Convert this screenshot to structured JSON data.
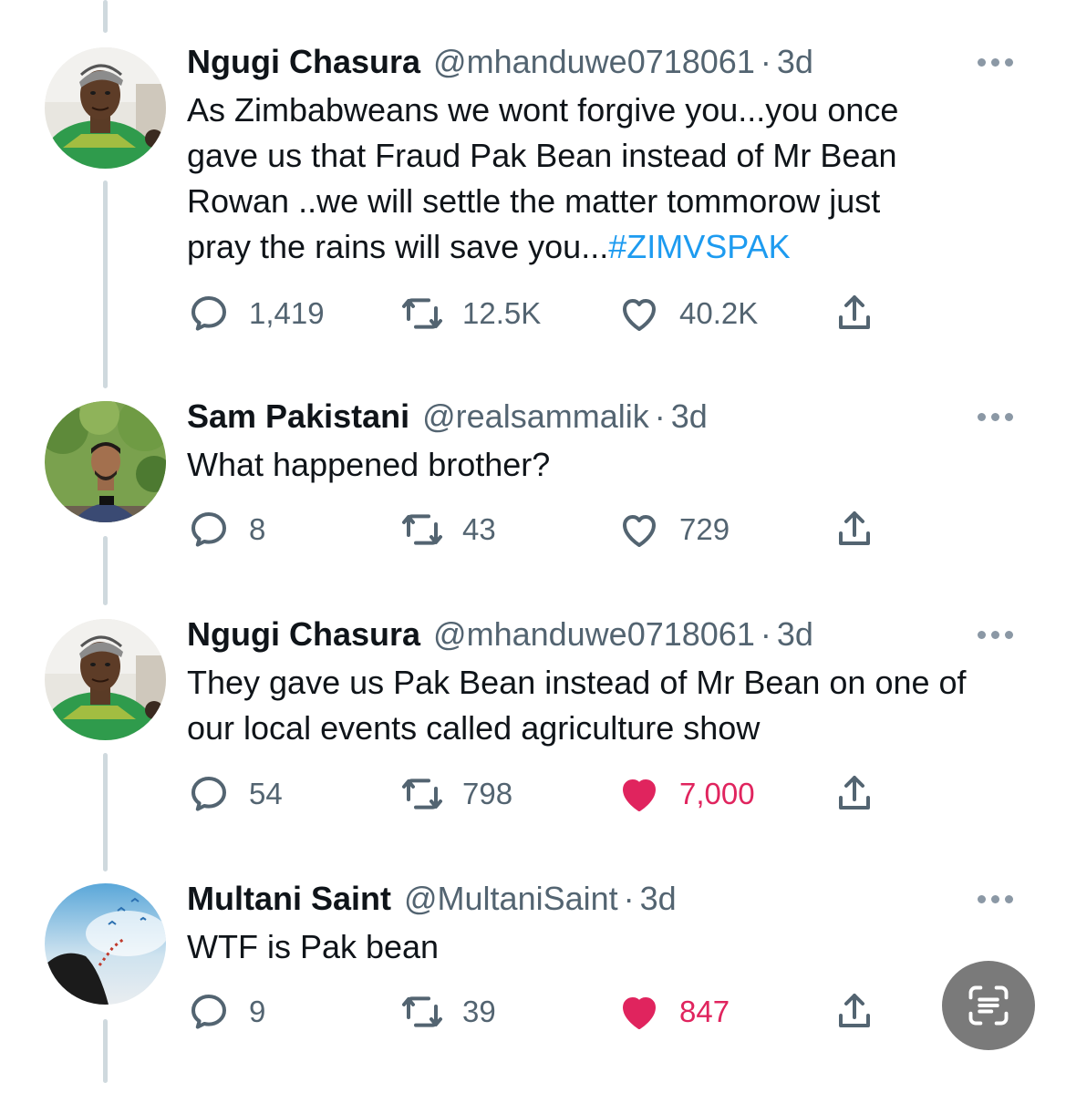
{
  "colors": {
    "link": "#1d9bf0",
    "like_active": "#e0245e",
    "muted": "#536471",
    "thread_line": "#cfd9de"
  },
  "tweets": [
    {
      "name": "Ngugi Chasura",
      "handle": "@mhanduwe0718061",
      "separator": "·",
      "time": "3d",
      "text_lines": [
        "As Zimbabweans we wont forgive you...you once",
        "gave us that Fraud Pak Bean instead of Mr Bean",
        "Rowan ..we will settle the matter tommorow just",
        "pray the rains will save you..."
      ],
      "hashtag": "#ZIMVSPAK",
      "replies": "1,419",
      "retweets": "12.5K",
      "likes": "40.2K",
      "liked": false,
      "avatar_icon": "person-green-jersey-avatar"
    },
    {
      "name": "Sam Pakistani",
      "handle": "@realsammalik",
      "separator": "·",
      "time": "3d",
      "text_lines": [
        "What happened brother?"
      ],
      "replies": "8",
      "retweets": "43",
      "likes": "729",
      "liked": false,
      "avatar_icon": "person-outdoor-avatar"
    },
    {
      "name": "Ngugi Chasura",
      "handle": "@mhanduwe0718061",
      "separator": "·",
      "time": "3d",
      "text_lines": [
        "They gave us Pak Bean instead of Mr Bean on one of",
        "our local events called agriculture show"
      ],
      "replies": "54",
      "retweets": "798",
      "likes": "7,000",
      "liked": true,
      "avatar_icon": "person-green-jersey-avatar"
    },
    {
      "name": "Multani Saint",
      "handle": "@MultaniSaint",
      "separator": "·",
      "time": "3d",
      "text_lines": [
        "WTF is Pak bean"
      ],
      "replies": "9",
      "retweets": "39",
      "likes": "847",
      "liked": true,
      "avatar_icon": "sky-birds-avatar"
    }
  ],
  "icons": {
    "reply": "reply-icon",
    "retweet": "retweet-icon",
    "like": "heart-icon",
    "share": "share-icon",
    "more": "more-options-icon",
    "scan": "text-scan-icon"
  }
}
